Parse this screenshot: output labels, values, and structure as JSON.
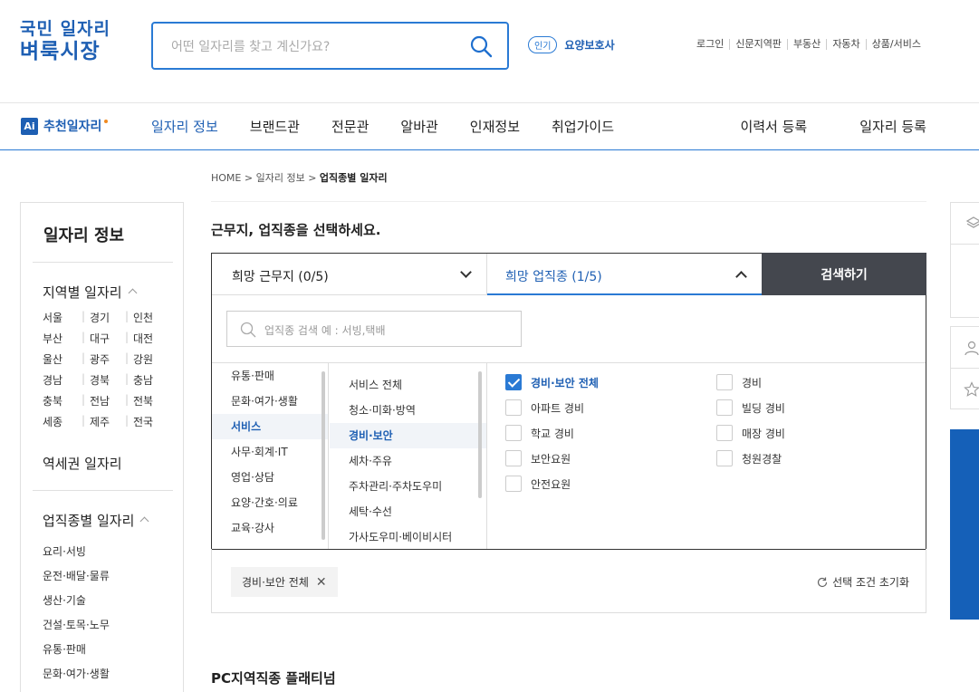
{
  "logo": {
    "line1": "국민 일자리",
    "line2": "벼룩시장"
  },
  "search": {
    "placeholder": "어떤 일자리를 찾고 계신가요?"
  },
  "hot": {
    "badge": "인기",
    "keyword": "요양보호사"
  },
  "util_links": [
    "로그인",
    "신문지역판",
    "부동산",
    "자동차",
    "상품/서비스"
  ],
  "gnb": {
    "ai_label": "추천일자리",
    "menu": [
      "일자리 정보",
      "브랜드관",
      "전문관",
      "알바관",
      "인재정보",
      "취업가이드"
    ],
    "right": [
      "이력서 등록",
      "일자리 등록"
    ]
  },
  "breadcrumb": {
    "home": "HOME",
    "mid": "일자리 정보",
    "current": "업직종별 일자리"
  },
  "headline": "근무지, 업직종을 선택하세요.",
  "sidebar": {
    "title": "일자리 정보",
    "region_title": "지역별 일자리",
    "regions": [
      [
        "서울",
        "경기",
        "인천"
      ],
      [
        "부산",
        "대구",
        "대전"
      ],
      [
        "울산",
        "광주",
        "강원"
      ],
      [
        "경남",
        "경북",
        "충남"
      ],
      [
        "충북",
        "전남",
        "전북"
      ],
      [
        "세종",
        "제주",
        "전국"
      ]
    ],
    "station_title": "역세권 일자리",
    "job_title": "업직종별 일자리",
    "jobs": [
      "요리·서빙",
      "운전·배달·물류",
      "생산·기술",
      "건설·토목·노무",
      "유통·판매",
      "문화·여가·생활"
    ]
  },
  "selector": {
    "tab_location": "희망 근무지 (0/5)",
    "tab_job": "희망 업직종 (1/5)",
    "search_button": "검색하기",
    "job_search_placeholder": "업직종 검색 예 : 서빙,택배",
    "col1": [
      "유통·판매",
      "문화·여가·생활",
      "서비스",
      "사무·회계·IT",
      "영업·상담",
      "요양·간호·의료",
      "교육·강사"
    ],
    "col1_selected": "서비스",
    "col2": [
      "서비스 전체",
      "청소·미화·방역",
      "경비·보안",
      "세차·주유",
      "주차관리·주차도우미",
      "세탁·수선",
      "가사도우미·베이비시터"
    ],
    "col2_selected": "경비·보안",
    "checks_left": [
      "경비·보안 전체",
      "아파트 경비",
      "학교 경비",
      "보안요원",
      "안전요원"
    ],
    "checks_right": [
      "경비",
      "빌딩 경비",
      "매장 경비",
      "청원경찰"
    ],
    "checked": "경비·보안 전체"
  },
  "selected_tag": "경비·보안 전체",
  "reset_label": "선택 조건 초기화",
  "platinum_title": "PC지역직종 플래티넘",
  "colors": {
    "brand": "#1e5fb3",
    "accent": "#2a7ad4",
    "dark_button": "#44474e",
    "banner": "#1560b8"
  }
}
